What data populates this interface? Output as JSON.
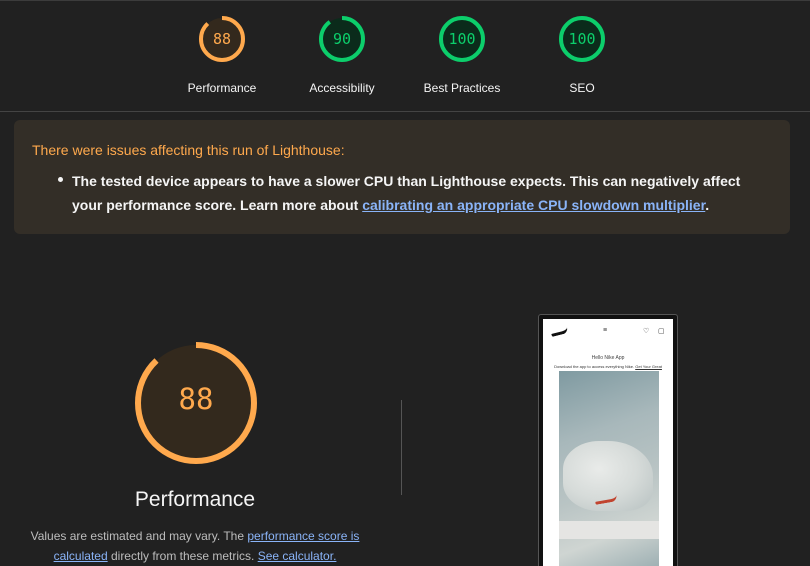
{
  "scores": [
    {
      "label": "Performance",
      "value": "88",
      "score": 0.88,
      "color": "#ffa94d",
      "bg": "#33291d"
    },
    {
      "label": "Accessibility",
      "value": "90",
      "score": 0.9,
      "color": "#0cce6b",
      "bg": "#0b2b1b"
    },
    {
      "label": "Best Practices",
      "value": "100",
      "score": 1.0,
      "color": "#0cce6b",
      "bg": "#0b2b1b"
    },
    {
      "label": "SEO",
      "value": "100",
      "score": 1.0,
      "color": "#0cce6b",
      "bg": "#0b2b1b"
    }
  ],
  "warning": {
    "title": "There were issues affecting this run of Lighthouse:",
    "text_before": "The tested device appears to have a slower CPU than Lighthouse expects. This can negatively affect your performance score. Learn more about ",
    "link": "calibrating an appropriate CPU slowdown multiplier",
    "text_after": "."
  },
  "performance": {
    "value": "88",
    "score": 0.88,
    "title": "Performance",
    "desc_before": "Values are estimated and may vary. The ",
    "desc_link": "performance score is calculated",
    "desc_middle": " directly from these metrics. ",
    "desc_link2": "See calculator."
  },
  "screenshot": {
    "title": "Hello Nike App",
    "subtitle_before": "Download the app to access everything Nike. ",
    "subtitle_link": "Get Your Great"
  },
  "colors": {
    "average": "#ffa94d",
    "pass": "#0cce6b",
    "link": "#8ab4f8"
  }
}
